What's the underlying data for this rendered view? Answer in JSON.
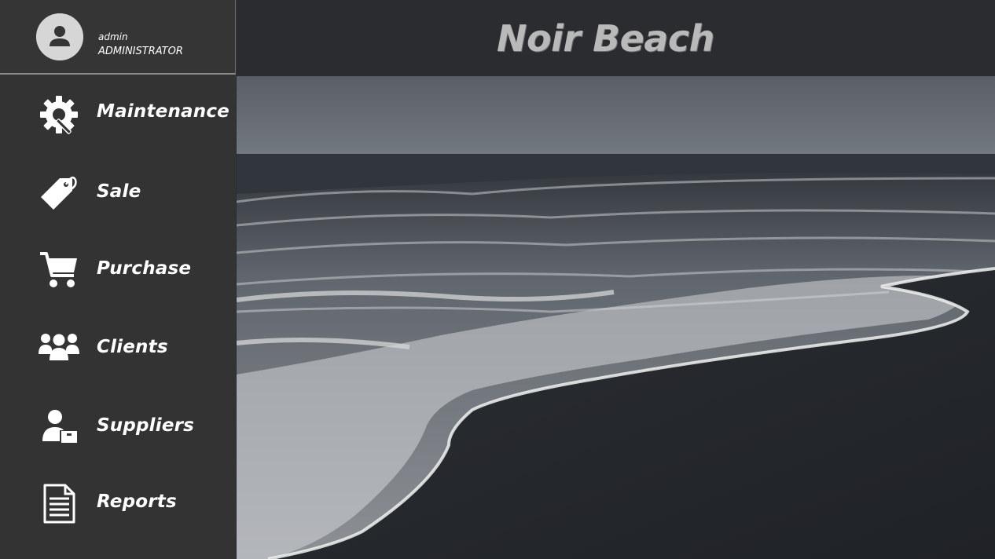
{
  "user": {
    "name": "admin",
    "role": "ADMINISTRATOR",
    "avatar_icon": "user-avatar-icon"
  },
  "header": {
    "title": "Noir Beach"
  },
  "menu": {
    "items": [
      {
        "label": "Maintenance",
        "icon": "gear-wrench-icon"
      },
      {
        "label": "Sale",
        "icon": "price-tag-icon"
      },
      {
        "label": "Purchase",
        "icon": "shopping-cart-icon"
      },
      {
        "label": "Clients",
        "icon": "users-group-icon"
      },
      {
        "label": "Suppliers",
        "icon": "supplier-box-icon"
      },
      {
        "label": "Reports",
        "icon": "document-icon"
      }
    ]
  },
  "colors": {
    "sidebar_bg": "#333333",
    "header_bg": "#2a2c30",
    "title_text": "#b9b9b9",
    "menu_text": "#ffffff"
  }
}
